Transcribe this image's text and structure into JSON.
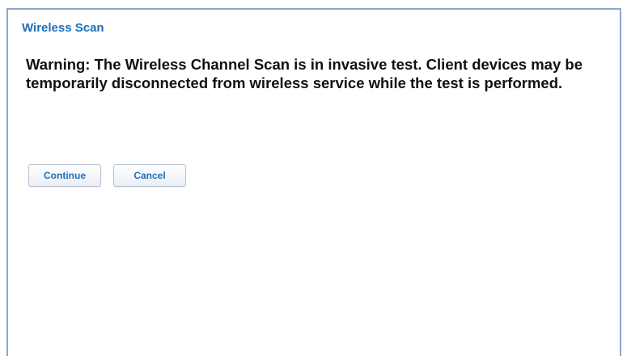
{
  "dialog": {
    "title": "Wireless Scan",
    "warning_text": "Warning: The Wireless Channel Scan is in invasive test. Client devices may be temporarily disconnected from wireless service while the test is performed.",
    "buttons": {
      "continue_label": "Continue",
      "cancel_label": "Cancel"
    }
  },
  "colors": {
    "title": "#1e6fb8",
    "border": "#8aa9cf",
    "button_text": "#1e6fb8"
  }
}
